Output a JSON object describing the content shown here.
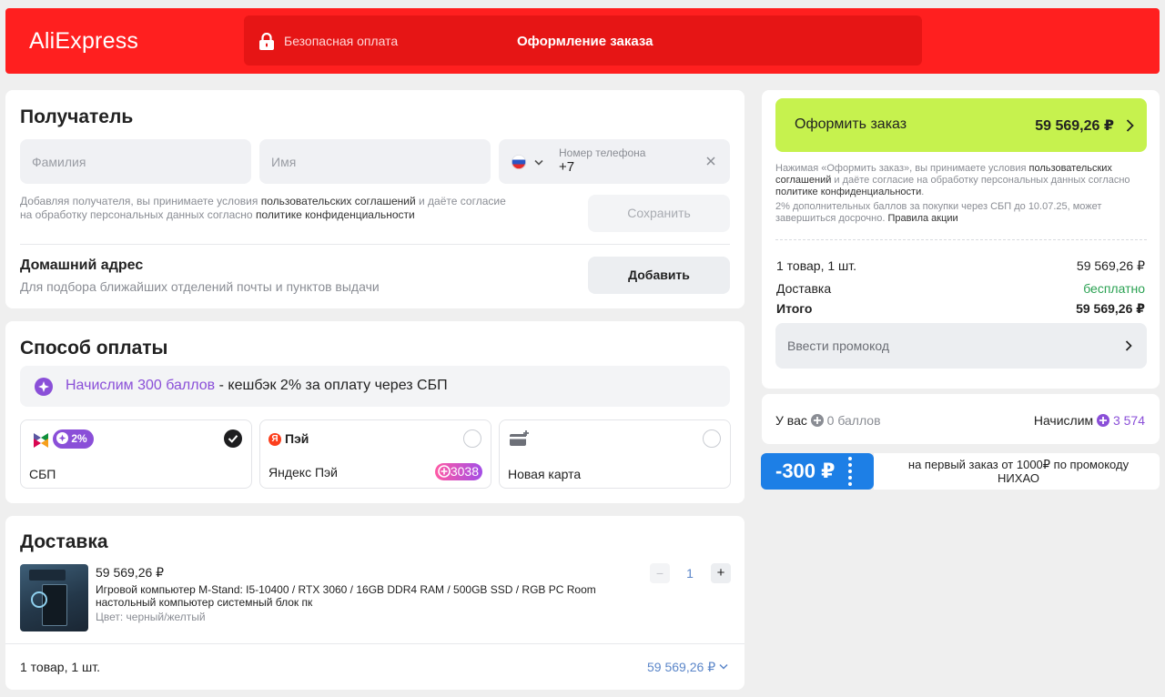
{
  "header": {
    "logo": "AliExpress",
    "secure_payment": "Безопасная оплата",
    "title": "Оформление заказа"
  },
  "recipient": {
    "title": "Получатель",
    "last_name_placeholder": "Фамилия",
    "first_name_placeholder": "Имя",
    "phone_label": "Номер телефона",
    "phone_value": "+7",
    "terms_part1": "Добавляя получателя, вы принимаете условия ",
    "terms_link1": "пользовательских соглашений",
    "terms_part2": " и даёте согласие",
    "terms_part3": "на обработку персональных данных согласно ",
    "terms_link2": "политике конфиденциальности",
    "save_button": "Сохранить"
  },
  "address": {
    "title": "Домашний адрес",
    "subtitle": "Для подбора ближайших отделений почты и пунктов выдачи",
    "add_button": "Добавить"
  },
  "payment": {
    "title": "Способ оплаты",
    "bonus_highlight": "Начислим 300 баллов",
    "bonus_rest": " - кешбэк 2% за оплату через СБП",
    "options": [
      {
        "label": "СБП",
        "badge": "2%",
        "selected": true
      },
      {
        "label": "Яндекс Пэй",
        "brand": "Пэй",
        "badge": "3038",
        "selected": false
      },
      {
        "label": "Новая карта",
        "selected": false
      }
    ]
  },
  "delivery": {
    "title": "Доставка",
    "item_price": "59 569,26 ₽",
    "item_name_line1": "Игровой компьютер M-Stand: I5-10400 / RTX 3060 / 16GB DDR4 RAM / 500GB SSD / RGB PC Room",
    "item_name_line2": "настольный компьютер системный блок пк",
    "item_color": "Цвет: черный/желтый",
    "quantity": "1",
    "minus": "−",
    "plus": "+",
    "footer_count": "1 товар, 1 шт.",
    "footer_total": "59 569,26 ₽"
  },
  "summary": {
    "order_button": "Оформить заказ",
    "order_total": "59 569,26 ₽",
    "terms_part1": "Нажимая «Оформить заказ», вы принимаете условия ",
    "terms_link1": "пользовательских соглашений",
    "terms_part2": " и даёте согласие на обработку персональных данных согласно ",
    "terms_link2": "политике конфиденциальности",
    "terms_part3": ".",
    "points_note": "2% дополнительных баллов за покупки через СБП до 10.07.25, может завершиться досрочно. ",
    "points_link": "Правила акции",
    "items_label": "1 товар, 1 шт.",
    "items_value": "59 569,26 ₽",
    "delivery_label": "Доставка",
    "delivery_value": "бесплатно",
    "total_label": "Итого",
    "total_value": "59 569,26 ₽",
    "promo_placeholder": "Ввести промокод",
    "balance_label": "У вас",
    "balance_value": "0 баллов",
    "earn_label": "Начислим",
    "earn_value": "3 574"
  },
  "coupon": {
    "discount": "-300 ₽",
    "text": "на первый заказ от 1000₽ по промокоду НИХАО"
  },
  "colors": {
    "brand_red": "#ff1f1f",
    "accent_green": "#c6f24e",
    "purple": "#8a4fd8",
    "link_blue": "#5b86c9",
    "free_green": "#2aa152",
    "coupon_blue": "#1d7fe6"
  }
}
